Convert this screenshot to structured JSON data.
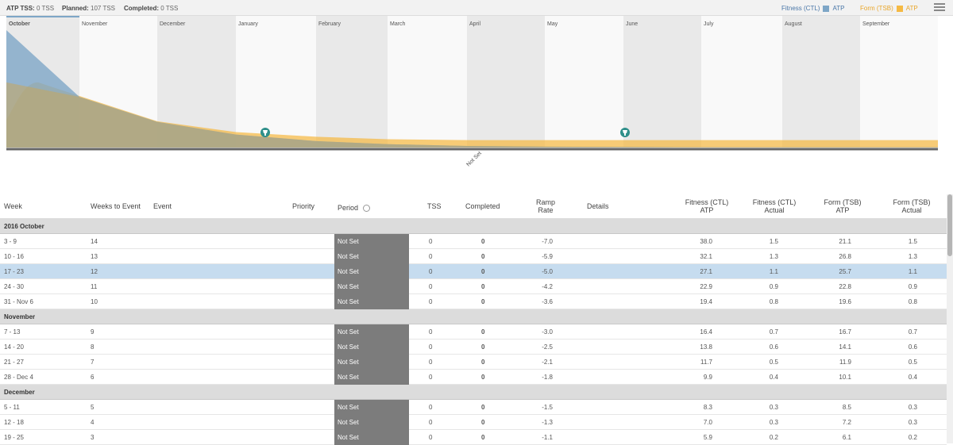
{
  "topbar": {
    "atp_label": "ATP TSS:",
    "atp_value": "0 TSS",
    "planned_label": "Planned:",
    "planned_value": "107 TSS",
    "completed_label": "Completed:",
    "completed_value": "0 TSS",
    "legend_fitness_label": "Fitness (CTL)",
    "legend_fitness_item": "ATP",
    "legend_form_label": "Form (TSB)",
    "legend_form_item": "ATP"
  },
  "colors": {
    "fitness": "#7ea6c7",
    "form": "#f5b943",
    "period": "#7c7c7c",
    "selected": "#c6dcef",
    "group": "#dcdcdc"
  },
  "icons": [
    "trophy-icon",
    "gear-icon",
    "menu-icon"
  ],
  "chart": {
    "months": [
      "October",
      "November",
      "December",
      "January",
      "February",
      "March",
      "April",
      "May",
      "June",
      "July",
      "August",
      "September"
    ],
    "axis_label": "Not Set",
    "event_markers": [
      "trophy-icon",
      "trophy-icon"
    ]
  },
  "chart_data": {
    "type": "area",
    "x": [
      "October",
      "November",
      "December",
      "January",
      "February",
      "March",
      "April",
      "May",
      "June",
      "July",
      "August",
      "September"
    ],
    "series": [
      {
        "name": "Fitness (CTL) ATP",
        "values": [
          38.0,
          16.4,
          8.3,
          4.2,
          2.1,
          1.1,
          0.5,
          0.3,
          0.2,
          0.1,
          0.1,
          0.1
        ]
      },
      {
        "name": "Form (TSB) ATP",
        "values": [
          21.1,
          16.7,
          8.5,
          5.0,
          3.5,
          2.7,
          2.4,
          2.4,
          2.4,
          2.4,
          2.4,
          2.4
        ]
      }
    ]
  },
  "table": {
    "headers": {
      "week": "Week",
      "weeks_to_event": "Weeks to Event",
      "event": "Event",
      "priority": "Priority",
      "period": "Period",
      "tss": "TSS",
      "completed": "Completed",
      "ramp_l1": "Ramp",
      "ramp_l2": "Rate",
      "details": "Details",
      "fit_atp_l1": "Fitness (CTL)",
      "fit_atp_l2": "ATP",
      "fit_act_l1": "Fitness (CTL)",
      "fit_act_l2": "Actual",
      "form_atp_l1": "Form (TSB)",
      "form_atp_l2": "ATP",
      "form_act_l1": "Form (TSB)",
      "form_act_l2": "Actual"
    },
    "rows": [
      {
        "group": "2016 October"
      },
      {
        "week": "3 - 9",
        "wte": "14",
        "period": "Not Set",
        "tss": "0",
        "completed": "0",
        "ramp": "-7.0",
        "fit_atp": "38.0",
        "fit_act": "1.5",
        "form_atp": "21.1",
        "form_act": "1.5"
      },
      {
        "week": "10 - 16",
        "wte": "13",
        "period": "Not Set",
        "tss": "0",
        "completed": "0",
        "ramp": "-5.9",
        "fit_atp": "32.1",
        "fit_act": "1.3",
        "form_atp": "26.8",
        "form_act": "1.3"
      },
      {
        "week": "17 - 23",
        "wte": "12",
        "period": "Not Set",
        "tss": "0",
        "completed": "0",
        "ramp": "-5.0",
        "fit_atp": "27.1",
        "fit_act": "1.1",
        "form_atp": "25.7",
        "form_act": "1.1",
        "selected": true
      },
      {
        "week": "24 - 30",
        "wte": "11",
        "period": "Not Set",
        "tss": "0",
        "completed": "0",
        "ramp": "-4.2",
        "fit_atp": "22.9",
        "fit_act": "0.9",
        "form_atp": "22.8",
        "form_act": "0.9"
      },
      {
        "week": "31 - Nov 6",
        "wte": "10",
        "period": "Not Set",
        "tss": "0",
        "completed": "0",
        "ramp": "-3.6",
        "fit_atp": "19.4",
        "fit_act": "0.8",
        "form_atp": "19.6",
        "form_act": "0.8"
      },
      {
        "group": "November"
      },
      {
        "week": "7 - 13",
        "wte": "9",
        "period": "Not Set",
        "tss": "0",
        "completed": "0",
        "ramp": "-3.0",
        "fit_atp": "16.4",
        "fit_act": "0.7",
        "form_atp": "16.7",
        "form_act": "0.7"
      },
      {
        "week": "14 - 20",
        "wte": "8",
        "period": "Not Set",
        "tss": "0",
        "completed": "0",
        "ramp": "-2.5",
        "fit_atp": "13.8",
        "fit_act": "0.6",
        "form_atp": "14.1",
        "form_act": "0.6"
      },
      {
        "week": "21 - 27",
        "wte": "7",
        "period": "Not Set",
        "tss": "0",
        "completed": "0",
        "ramp": "-2.1",
        "fit_atp": "11.7",
        "fit_act": "0.5",
        "form_atp": "11.9",
        "form_act": "0.5"
      },
      {
        "week": "28 - Dec 4",
        "wte": "6",
        "period": "Not Set",
        "tss": "0",
        "completed": "0",
        "ramp": "-1.8",
        "fit_atp": "9.9",
        "fit_act": "0.4",
        "form_atp": "10.1",
        "form_act": "0.4"
      },
      {
        "group": "December"
      },
      {
        "week": "5 - 11",
        "wte": "5",
        "period": "Not Set",
        "tss": "0",
        "completed": "0",
        "ramp": "-1.5",
        "fit_atp": "8.3",
        "fit_act": "0.3",
        "form_atp": "8.5",
        "form_act": "0.3"
      },
      {
        "week": "12 - 18",
        "wte": "4",
        "period": "Not Set",
        "tss": "0",
        "completed": "0",
        "ramp": "-1.3",
        "fit_atp": "7.0",
        "fit_act": "0.3",
        "form_atp": "7.2",
        "form_act": "0.3"
      },
      {
        "week": "19 - 25",
        "wte": "3",
        "period": "Not Set",
        "tss": "0",
        "completed": "0",
        "ramp": "-1.1",
        "fit_atp": "5.9",
        "fit_act": "0.2",
        "form_atp": "6.1",
        "form_act": "0.2"
      }
    ]
  }
}
